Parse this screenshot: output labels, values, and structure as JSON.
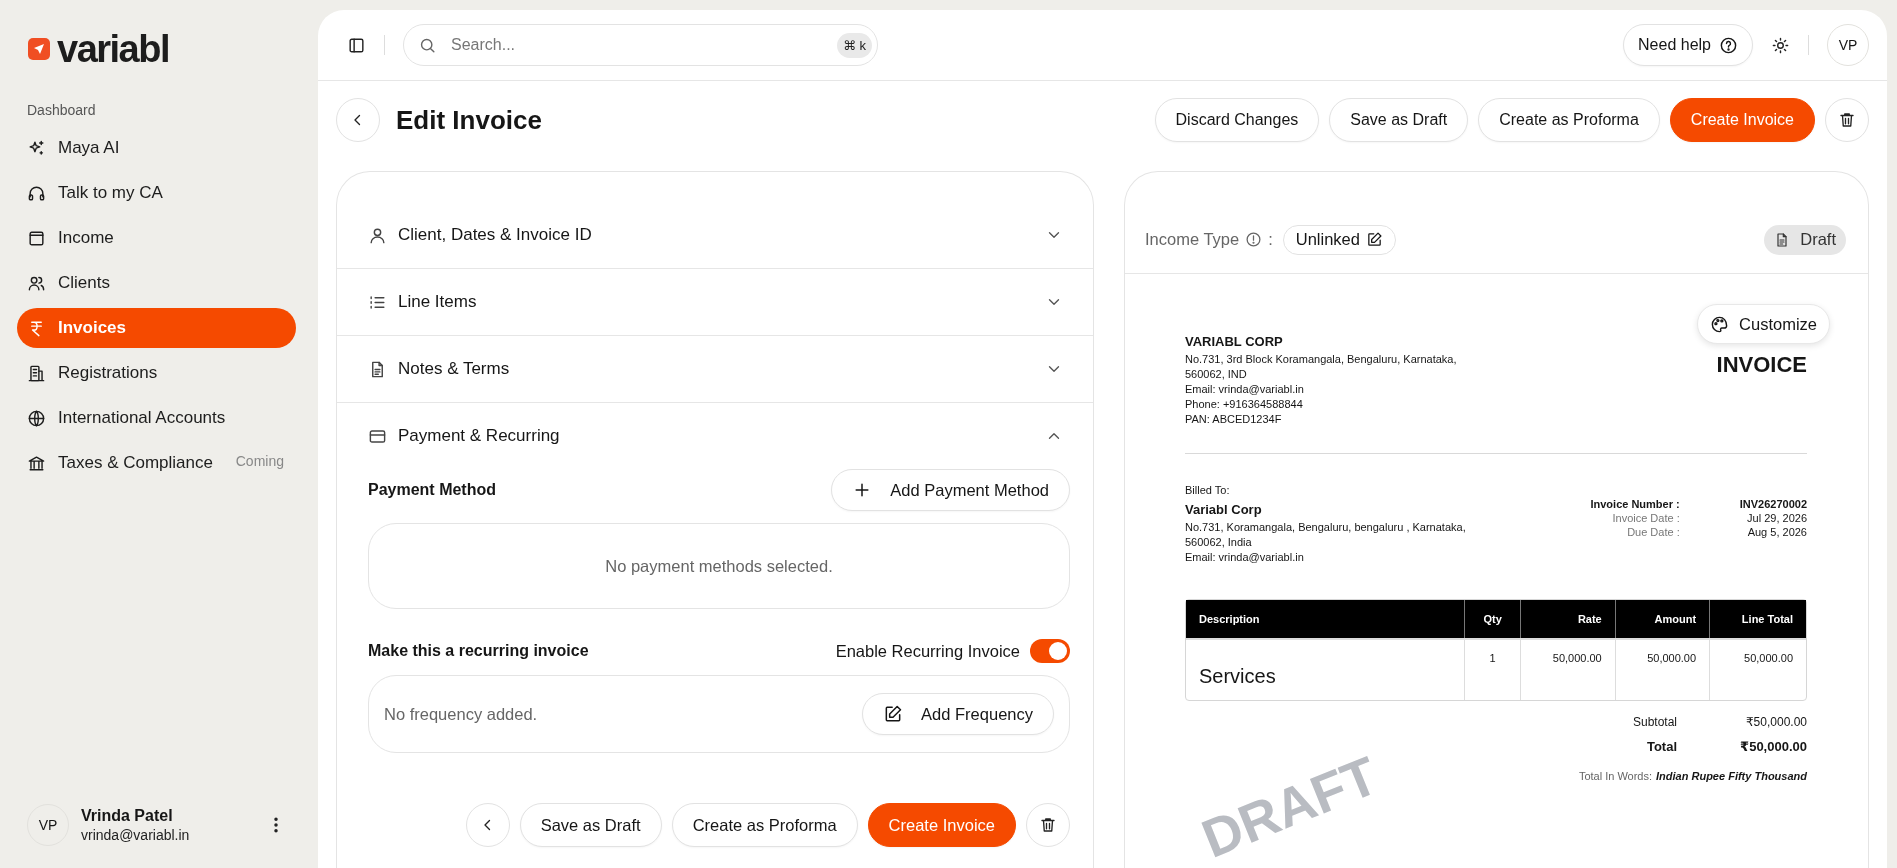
{
  "sidebar": {
    "logo": "variabl",
    "section_label": "Dashboard",
    "items": [
      {
        "label": "Maya AI",
        "selected": false
      },
      {
        "label": "Talk to my CA",
        "selected": false
      },
      {
        "label": "Income",
        "selected": false
      },
      {
        "label": "Clients",
        "selected": false
      },
      {
        "label": "Invoices",
        "selected": true
      },
      {
        "label": "Registrations",
        "selected": false
      },
      {
        "label": "International Accounts",
        "selected": false
      },
      {
        "label": "Taxes & Compliance",
        "selected": false,
        "badge": "Coming"
      }
    ],
    "user": {
      "initials": "VP",
      "name": "Vrinda Patel",
      "email": "vrinda@variabl.in"
    }
  },
  "topbar": {
    "search": {
      "placeholder": "Search...",
      "shortcut_symbol": "⌘",
      "shortcut_key": "k"
    },
    "help_button": "Need help",
    "avatar": "VP"
  },
  "header": {
    "title": "Edit Invoice",
    "buttons": [
      {
        "label": "Discard Changes",
        "kind": "secondary"
      },
      {
        "label": "Save as Draft",
        "kind": "secondary"
      },
      {
        "label": "Create as Proforma",
        "kind": "secondary"
      },
      {
        "label": "Create Invoice",
        "kind": "primary"
      }
    ]
  },
  "form": {
    "sections": [
      {
        "title": "Client, Dates & Invoice ID",
        "expanded": false
      },
      {
        "title": "Line Items",
        "expanded": false
      },
      {
        "title": "Notes & Terms",
        "expanded": false
      },
      {
        "title": "Payment & Recurring",
        "expanded": true
      }
    ],
    "payment": {
      "title": "Payment Method",
      "add_button": "Add Payment Method",
      "empty_text": "No payment methods selected."
    },
    "recurring": {
      "title": "Make this a recurring invoice",
      "toggle_label": "Enable Recurring Invoice",
      "on": true,
      "empty_text": "No frequency added.",
      "add_button": "Add Frequency"
    },
    "footer_buttons": [
      {
        "label": "Save as Draft",
        "kind": "secondary"
      },
      {
        "label": "Create as Proforma",
        "kind": "secondary"
      },
      {
        "label": "Create Invoice",
        "kind": "primary"
      }
    ]
  },
  "preview": {
    "income_type_label": "Income Type",
    "separator": ":",
    "income_type_value": "Unlinked",
    "status_badge": "Draft",
    "customize_button": "Customize",
    "watermark": "DRAFT",
    "invoice": {
      "title": "INVOICE",
      "company": {
        "name": "VARIABL CORP",
        "lines": [
          "No.731, 3rd Block Koramangala, Bengaluru, Karnataka,",
          "560062, IND",
          "Email: vrinda@variabl.in",
          "Phone: +916364588844",
          "PAN: ABCED1234F"
        ]
      },
      "billed_to_label": "Billed To:",
      "client": {
        "name": "Variabl Corp",
        "lines": [
          "No.731, Koramangala, Bengaluru, bengaluru , Karnataka,",
          "560062, India",
          "Email: vrinda@variabl.in"
        ]
      },
      "meta": [
        {
          "label": "Invoice Number :",
          "value": "INV26270002",
          "kind": "strong"
        },
        {
          "label": "Invoice Date :",
          "value": "Jul 29, 2026",
          "kind": "normal"
        },
        {
          "label": "Due Date :",
          "value": "Aug 5, 2026",
          "kind": "normal"
        }
      ],
      "table": {
        "columns": [
          "Description",
          "Qty",
          "Rate",
          "Amount",
          "Line Total"
        ],
        "rows": [
          [
            "Services",
            "1",
            "50,000.00",
            "50,000.00",
            "50,000.00"
          ]
        ]
      },
      "totals": [
        {
          "label": "Subtotal",
          "value": "₹50,000.00",
          "kind": "normal"
        },
        {
          "label": "Total",
          "value": "₹50,000.00",
          "kind": "strong"
        }
      ],
      "total_in_words": {
        "label": "Total In Words:",
        "value": "Indian Rupee Fifty Thousand"
      }
    }
  }
}
